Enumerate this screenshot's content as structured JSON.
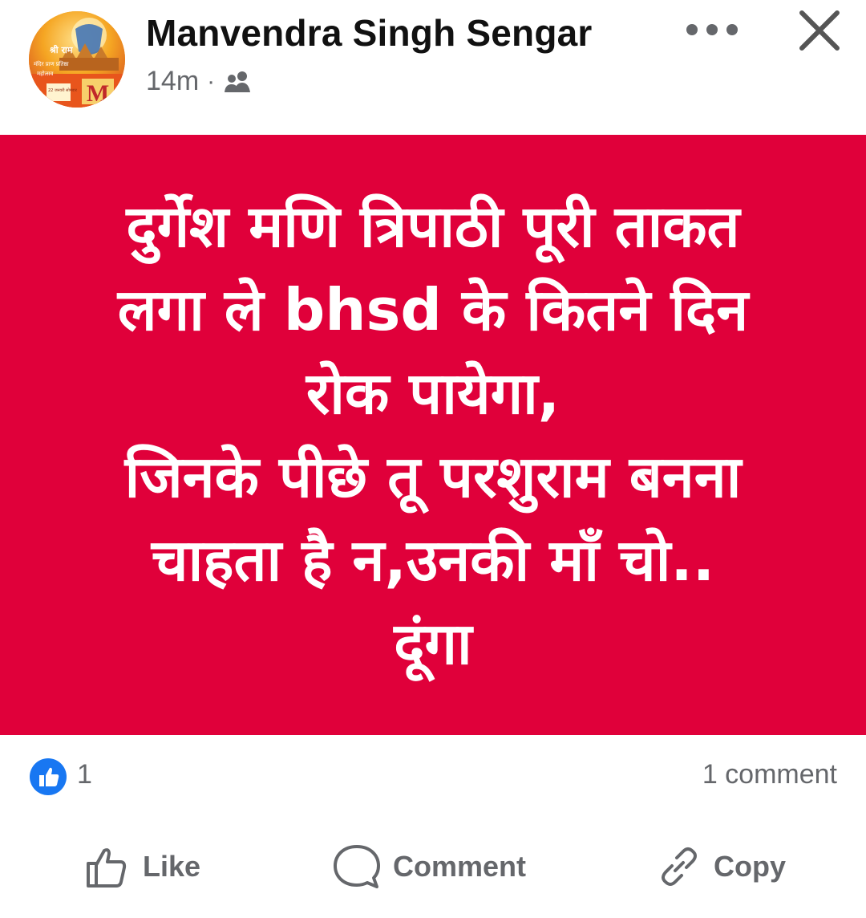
{
  "post": {
    "author": "Manvendra Singh Sengar",
    "time": "14m",
    "separator": "·",
    "audience_icon": "friends-icon",
    "card_color": "#e0003a",
    "text_lines": [
      "दुर्गेश मणि त्रिपाठी पूरी ताकत",
      "लगा ले bhsd के कितने दिन",
      "रोक पायेगा,",
      "जिनके पीछे तू परशुराम बनना",
      "चाहता है न,उनकी माँ चो..",
      "दूंगा"
    ]
  },
  "avatar": {
    "badge_letter": "M",
    "top_text": "श्री राम",
    "line2": "मंदिर प्राण प्रतिष्ठा",
    "line3": "महोत्सव",
    "line4": "22 जनवरी सोमवार"
  },
  "reactions": {
    "like_count": "1",
    "comment_count": "1 comment",
    "accent": "#1877f2"
  },
  "actions": {
    "like": "Like",
    "comment": "Comment",
    "copy": "Copy"
  }
}
